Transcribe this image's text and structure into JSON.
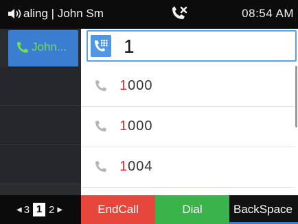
{
  "status": {
    "call_text": "aling | John Sm",
    "time": "08:54 AM"
  },
  "account": {
    "label": "John..."
  },
  "input": {
    "value": "1"
  },
  "results": [
    {
      "highlight": "1",
      "rest": "000"
    },
    {
      "highlight": "1",
      "rest": "000"
    },
    {
      "highlight": "1",
      "rest": "004"
    }
  ],
  "pager": {
    "prev": "3",
    "current": "1",
    "next": "2"
  },
  "softkeys": {
    "end_call": "EndCall",
    "dial": "Dial",
    "backspace": "BackSpace"
  },
  "colors": {
    "accent_blue": "#4f98e8",
    "end_red": "#e6473a",
    "dial_green": "#39b34a",
    "match_red": "#e52b2b",
    "account_green": "#6fe04a"
  },
  "icons": [
    "speaker-icon",
    "missed-call-icon",
    "phone-icon",
    "dialpad-icon",
    "chevron-left-icon",
    "chevron-right-icon"
  ]
}
